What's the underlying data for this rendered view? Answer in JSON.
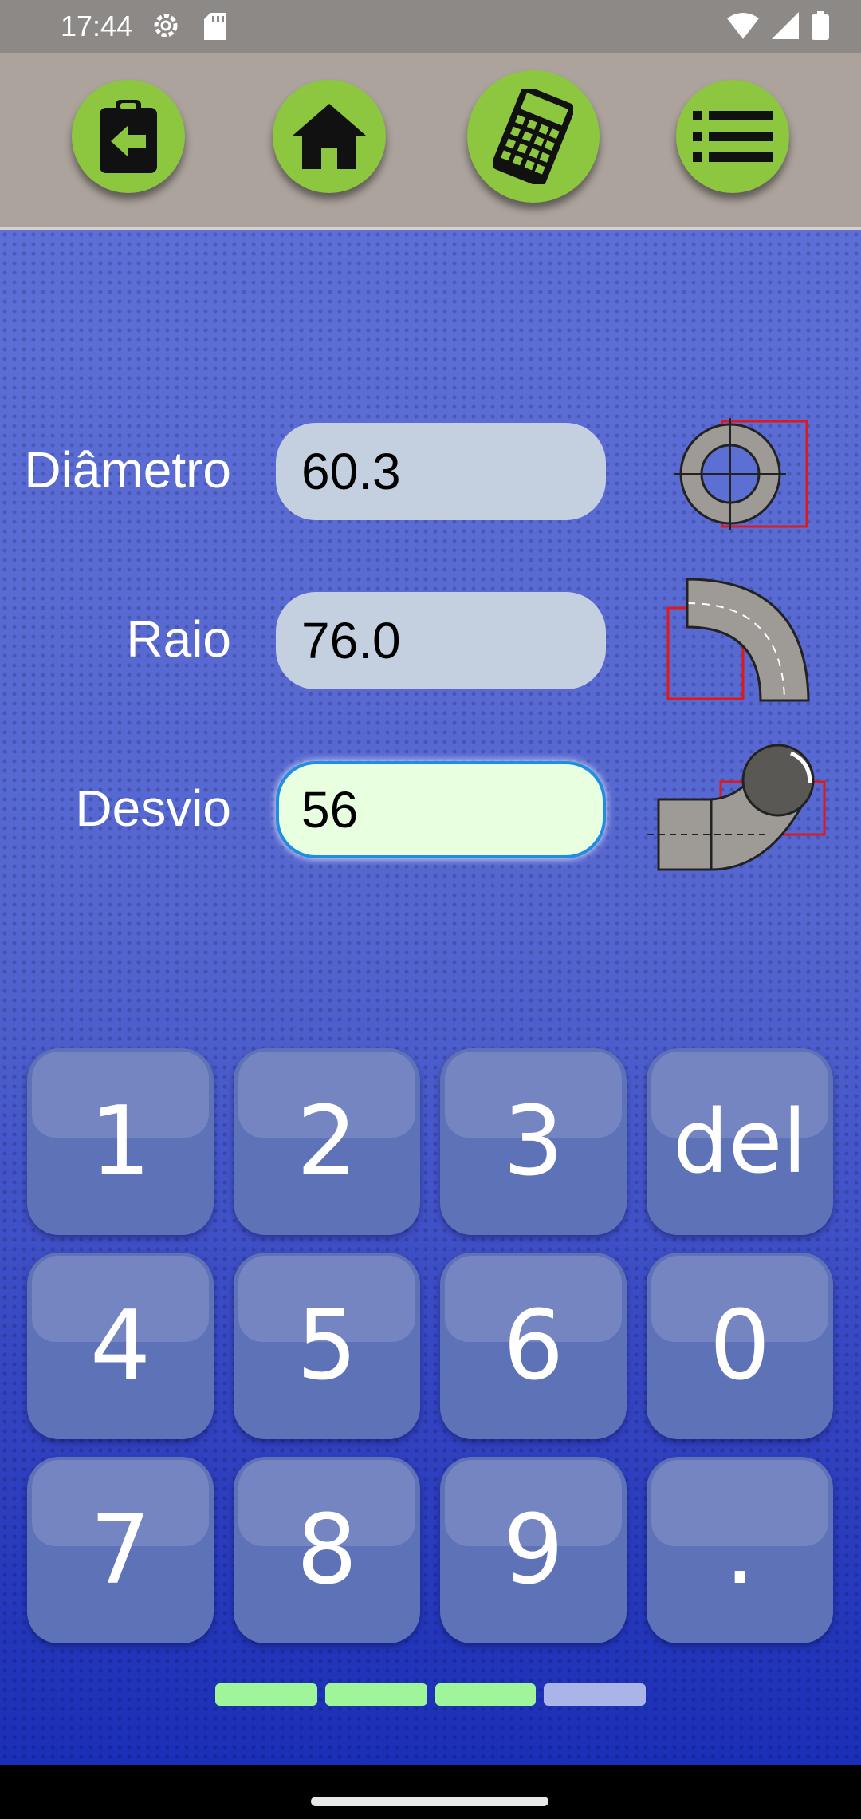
{
  "status_bar": {
    "time": "17:44",
    "icons": [
      "gear-icon",
      "sd-card-icon",
      "wifi-icon",
      "signal-icon",
      "battery-icon"
    ]
  },
  "toolbar": {
    "buttons": [
      {
        "name": "clipboard-back-button",
        "icon": "clipboard-back-icon"
      },
      {
        "name": "home-button",
        "icon": "home-icon"
      },
      {
        "name": "calculator-button",
        "icon": "calculator-icon"
      },
      {
        "name": "list-button",
        "icon": "list-icon"
      }
    ],
    "color": "#8dc63f"
  },
  "fields": {
    "diametro": {
      "label": "Diâmetro",
      "value": "60.3",
      "icon": "pipe-cross-section-icon"
    },
    "raio": {
      "label": "Raio",
      "value": "76.0",
      "icon": "elbow-radius-icon"
    },
    "desvio": {
      "label": "Desvio",
      "value": "56",
      "icon": "elbow-offset-icon"
    }
  },
  "keypad": {
    "keys": [
      "1",
      "2",
      "3",
      "del",
      "4",
      "5",
      "6",
      "0",
      "7",
      "8",
      "9",
      "."
    ]
  },
  "progress": {
    "segments": 4,
    "completed": 3,
    "active_color": "#9ff59a",
    "inactive_color": "#aab4e8"
  }
}
